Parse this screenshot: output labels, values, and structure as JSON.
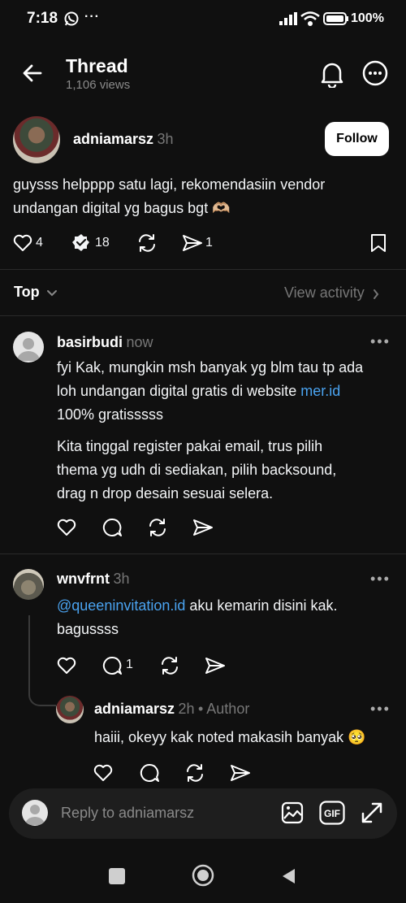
{
  "status_bar": {
    "time": "7:18",
    "dots": "···",
    "battery": "100%"
  },
  "header": {
    "title": "Thread",
    "views": "1,106 views"
  },
  "post": {
    "username": "adniamarsz",
    "time": "3h",
    "follow_label": "Follow",
    "text_line1": "guysss helpppp satu lagi, rekomendasiin vendor",
    "text_line2": "undangan digital yg bagus bgt 🫶🏼",
    "likes": "4",
    "reposts": "18",
    "shares": "1"
  },
  "sort": {
    "label": "Top",
    "view_activity": "View activity"
  },
  "comments": [
    {
      "username": "basirbudi",
      "time": "now",
      "line1": "fyi Kak, mungkin msh banyak yg blm tau tp ada",
      "line2_prefix": "loh undangan digital gratis di website ",
      "line2_link": "mer.id",
      "line3": "100% gratisssss",
      "para2_line1": "Kita tinggal register pakai email, trus pilih",
      "para2_line2": "thema yg udh di sediakan, pilih backsound,",
      "para2_line3": "drag n drop desain sesuai selera."
    },
    {
      "username": "wnvfrnt",
      "time": "3h",
      "mention": "@queeninvitation.id",
      "text_rest": " aku kemarin disini kak.",
      "line2": "bagussss",
      "reply_count": "1"
    },
    {
      "username": "adniamarsz",
      "time": "2h",
      "author_tag": "• Author",
      "text": "haiii, okeyy kak noted makasih banyak 🥺"
    }
  ],
  "reply_bar": {
    "placeholder": "Reply to adniamarsz"
  }
}
